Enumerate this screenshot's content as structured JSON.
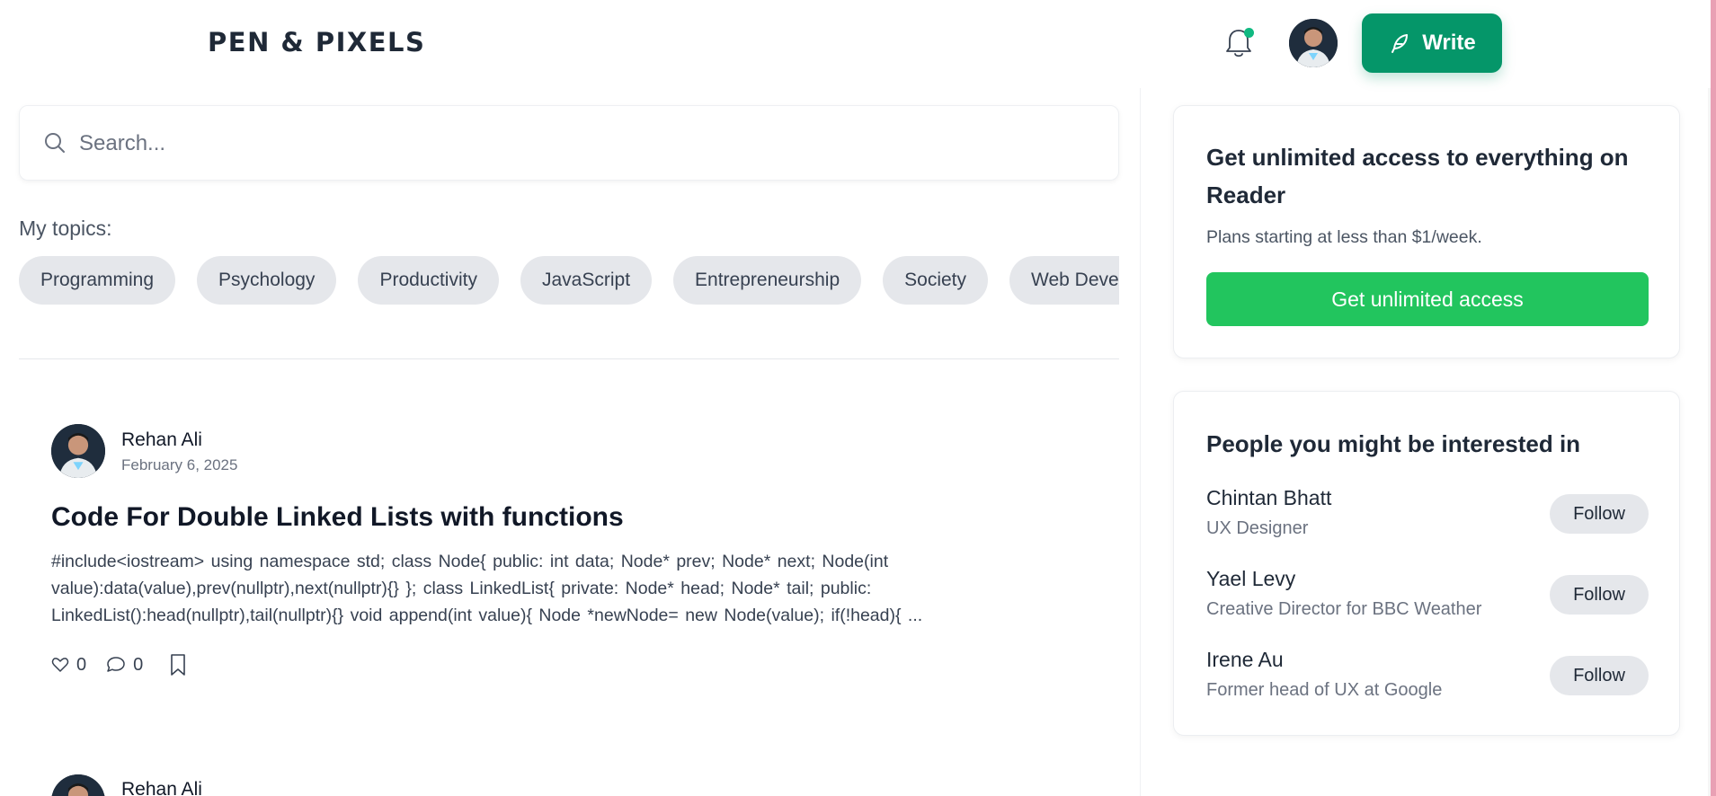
{
  "header": {
    "logo": "PEN & PIXELS",
    "write_label": "Write",
    "notification_dot_color": "#10b981",
    "accent": "#059669"
  },
  "search": {
    "placeholder": "Search..."
  },
  "topics": {
    "label": "My topics:",
    "items": [
      "Programming",
      "Psychology",
      "Productivity",
      "JavaScript",
      "Entrepreneurship",
      "Society",
      "Web Development"
    ]
  },
  "posts": [
    {
      "author": "Rehan Ali",
      "date": "February 6, 2025",
      "title": "Code For Double Linked Lists with functions",
      "excerpt": "#include<iostream> using namespace std; class Node{ public:     int data;     Node* prev;     Node* next;     Node(int value):data(value),prev(nullptr),next(nullptr){} }; class LinkedList{ private:     Node* head;     Node* tail; public:     LinkedList():head(nullptr),tail(nullptr){}     void append(int value){         Node *newNode= new Node(value);         if(!head){         ...",
      "likes": "0",
      "comments": "0"
    },
    {
      "author": "Rehan Ali"
    }
  ],
  "sidebar": {
    "membership": {
      "title": "Get unlimited access to everything on Reader",
      "subtitle": "Plans starting at less than $1/week.",
      "cta": "Get unlimited access",
      "cta_color": "#22c55e"
    },
    "people": {
      "title": "People you might be interested in",
      "follow_label": "Follow",
      "items": [
        {
          "name": "Chintan Bhatt",
          "role": "UX Designer"
        },
        {
          "name": "Yael Levy",
          "role": "Creative Director for BBC Weather"
        },
        {
          "name": "Irene Au",
          "role": "Former head of UX at Google"
        }
      ]
    }
  }
}
